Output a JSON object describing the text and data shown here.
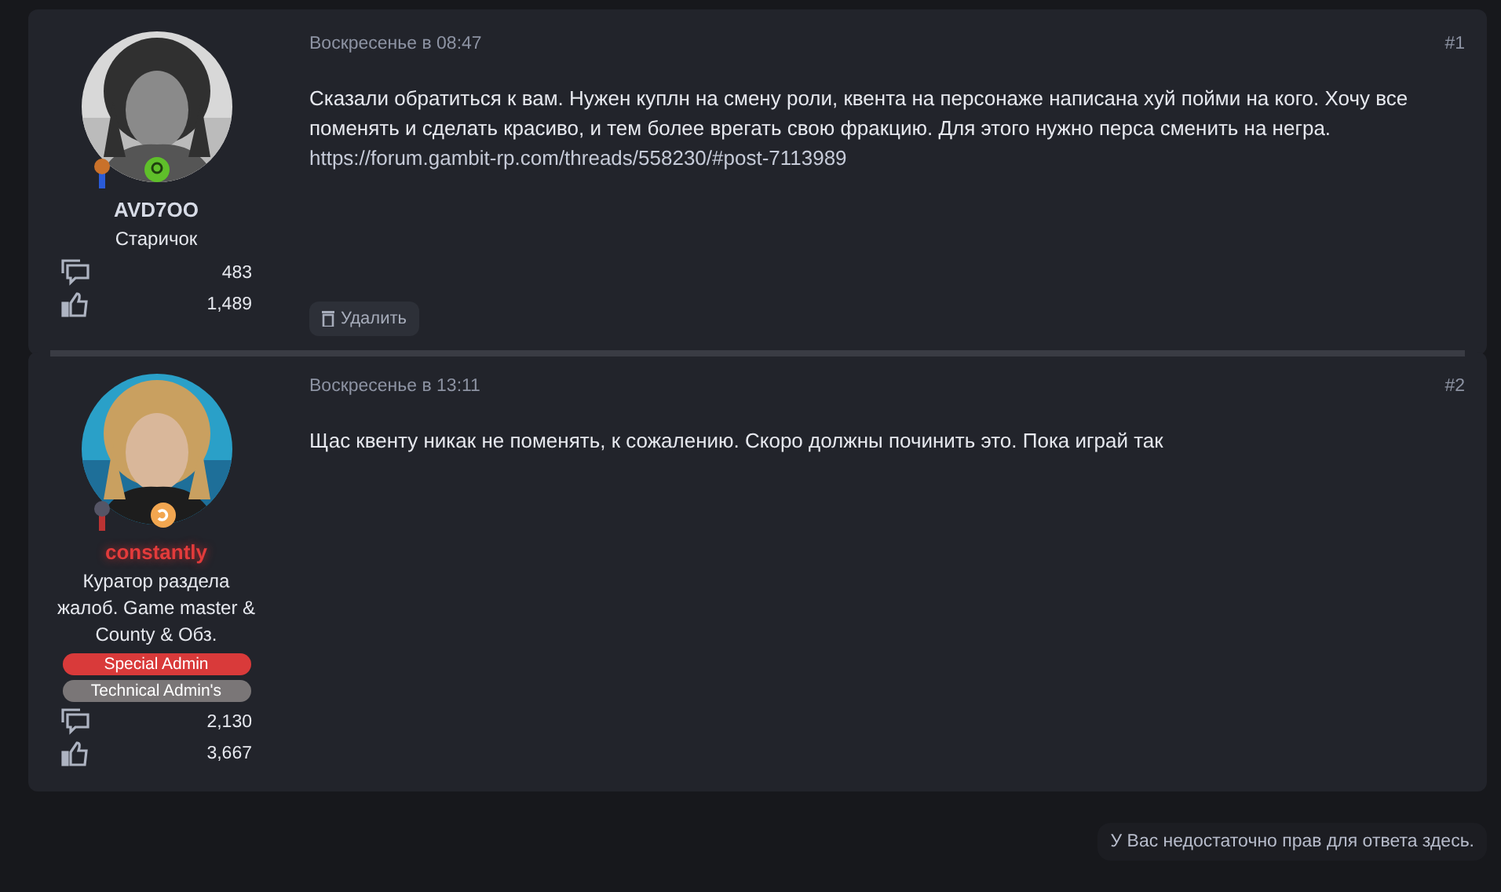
{
  "posts": [
    {
      "author": {
        "name": "AVD7OO",
        "kind": "plain",
        "title": "Старичок",
        "messages": "483",
        "reactions": "1,489"
      },
      "date": "Воскресенье в 08:47",
      "number": "#1",
      "body": "Сказали обратиться к вам. Нужен куплн на смену роли, квента на персонаже написана хуй пойми на кого. Хочу все поменять и сделать красиво, и тем более врегать свою фракцию. Для этого нужно перса сменить на негра.",
      "link": "https://forum.gambit-rp.com/threads/558230/#post-7113989",
      "actions": [
        "Удалить"
      ]
    },
    {
      "author": {
        "name": "constantly",
        "kind": "staff",
        "title": "Куратор раздела жалоб. Game master & County & Обз.",
        "banners": [
          {
            "label": "Special Admin",
            "color": "#d93a3a"
          },
          {
            "label": "Technical Admin's",
            "color": "#7a7677"
          }
        ],
        "messages": "2,130",
        "reactions": "3,667"
      },
      "date": "Воскресенье в 13:11",
      "number": "#2",
      "body": "Щас квенту никак не поменять, к сожалению. Скоро должны починить это. Пока играй так"
    }
  ],
  "notice": "У Вас недостаточно прав для ответа здесь."
}
